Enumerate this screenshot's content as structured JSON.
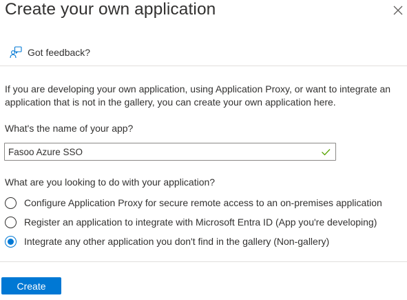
{
  "panel": {
    "title": "Create your own application",
    "feedback_label": "Got feedback?",
    "description": "If you are developing your own application, using Application Proxy, or want to integrate an application that is not in the gallery, you can create your own application here."
  },
  "form": {
    "name_label": "What's the name of your app?",
    "name_value": "Fasoo Azure SSO",
    "name_valid": true,
    "question": "What are you looking to do with your application?",
    "options": [
      {
        "label": "Configure Application Proxy for secure remote access to an on-premises application",
        "selected": false
      },
      {
        "label": "Register an application to integrate with Microsoft Entra ID (App you're developing)",
        "selected": false
      },
      {
        "label": "Integrate any other application you don't find in the gallery (Non-gallery)",
        "selected": true
      }
    ]
  },
  "actions": {
    "create_label": "Create"
  },
  "icons": {
    "close": "close-icon",
    "feedback": "feedback-person-icon",
    "valid": "checkmark-icon"
  },
  "colors": {
    "accent": "#0078d4",
    "valid": "#57a300",
    "text": "#323130",
    "divider": "#e1dfdd"
  }
}
